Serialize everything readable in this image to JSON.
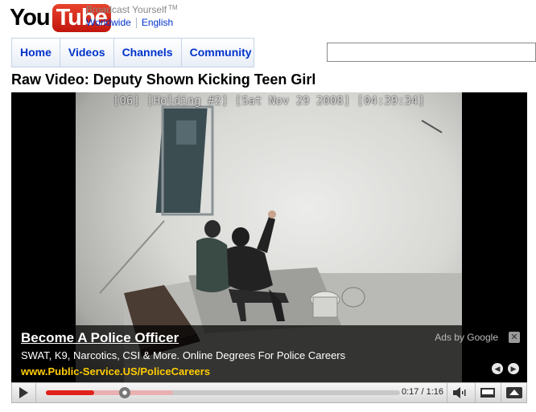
{
  "header": {
    "logo_you": "You",
    "logo_tube": "Tube",
    "tagline": "Broadcast Yourself",
    "tm": "TM",
    "locale_region": "Worldwide",
    "locale_language": "English"
  },
  "nav": {
    "items": [
      "Home",
      "Videos",
      "Channels",
      "Community"
    ]
  },
  "search": {
    "value": ""
  },
  "video": {
    "title": "Raw Video: Deputy Shown Kicking Teen Girl",
    "osd": "[06] [Holding #2] [Sat Nov 29 2008] [04:39:34]"
  },
  "ad": {
    "headline": "Become A Police Officer",
    "text": "SWAT, K9, Narcotics, CSI & More. Online Degrees For Police Careers",
    "url": "www.Public-Service.US/PoliceCareers",
    "by_label": "Ads by Google",
    "close_icon": "close-icon",
    "prev_icon": "chevron-left-icon",
    "next_icon": "chevron-right-icon"
  },
  "player": {
    "time_current": "0:17",
    "time_total": "1:16",
    "progress_fraction": 0.2237,
    "buffered_fraction": 0.1364,
    "play_icon": "play-icon",
    "volume_icon": "volume-icon",
    "size_icon": "screen-size-icon",
    "fullscreen_icon": "fullscreen-icon"
  },
  "colors": {
    "link": "#0033cc",
    "progress": "#e0201a",
    "ad_url": "#ffcc00",
    "logo_red": "#c2160e"
  }
}
